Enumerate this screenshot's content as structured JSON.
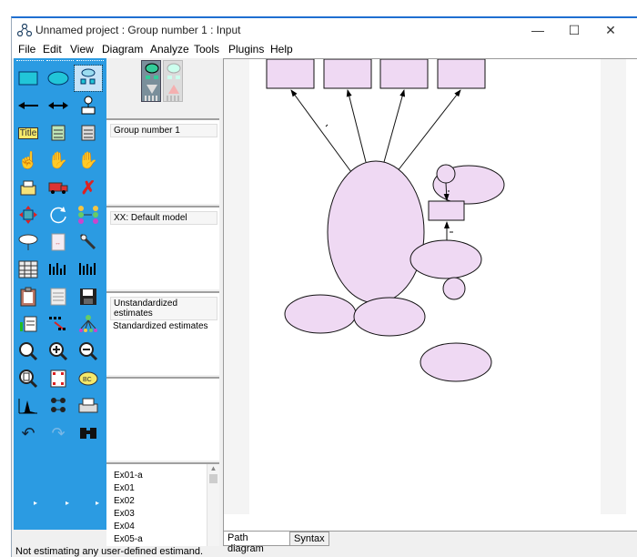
{
  "window": {
    "title": "Unnamed project : Group number 1 : Input",
    "controls": {
      "minimize": "—",
      "maximize": "☐",
      "close": "✕"
    }
  },
  "menu": [
    "File",
    "Edit",
    "View",
    "Diagram",
    "Analyze",
    "Tools",
    "Plugins",
    "Help"
  ],
  "toolbox": {
    "tools": [
      "draw-observed-rectangle-icon",
      "draw-unobserved-ellipse-icon",
      "draw-latent-indicator-icon",
      "draw-path-icon",
      "draw-covariance-icon",
      "add-unique-variable-icon",
      "figure-caption-icon",
      "list-variables-in-model-icon",
      "list-variables-in-dataset-icon",
      "select-one-object-icon",
      "select-all-objects-icon",
      "deselect-all-icon",
      "duplicate-object-icon",
      "move-object-icon",
      "erase-object-icon",
      "change-shape-icon",
      "rotate-indicators-icon",
      "reflect-indicators-icon",
      "move-parameter-icon",
      "scroll-diagram-icon",
      "touch-up-icon",
      "data-files-icon",
      "analysis-properties-icon",
      "calculate-estimates-icon",
      "copy-to-clipboard-icon",
      "view-text-icon",
      "save-diagram-icon",
      "object-properties-icon",
      "drag-properties-icon",
      "preserve-symmetries-icon",
      "zoom-in-area-icon",
      "zoom-in-icon",
      "zoom-out-icon",
      "page-view-icon",
      "fit-to-page-icon",
      "magnify-icon",
      "degrees-of-freedom-icon",
      "multiple-group-icon",
      "print-icon",
      "undo-icon",
      "redo-icon",
      "specification-search-icon"
    ]
  },
  "panels": {
    "groups": {
      "header": "Group number 1"
    },
    "models": {
      "header": "XX: Default model"
    },
    "estimates": {
      "items": [
        "Unstandardized estimates",
        "Standardized estimates"
      ]
    },
    "files": {
      "items": [
        "Ex01-a",
        "Ex01",
        "Ex02",
        "Ex03",
        "Ex04",
        "Ex05-a"
      ]
    }
  },
  "tabs": {
    "path_diagram": "Path diagram",
    "syntax": "Syntax"
  },
  "colors": {
    "shape_fill": "#efd9f3",
    "toolbox": "#2b9be2"
  },
  "status": "Not estimating any user-defined estimand."
}
